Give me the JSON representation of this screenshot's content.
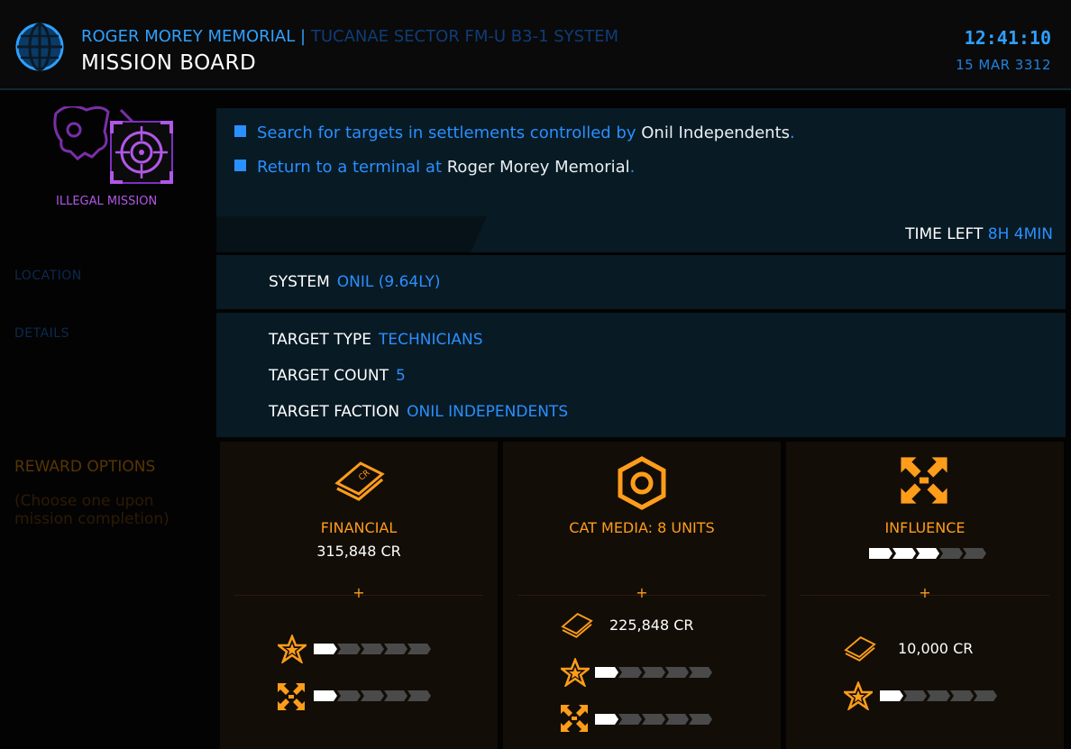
{
  "header": {
    "station": "ROGER MOREY MEMORIAL",
    "separator": "|",
    "system": "TUCANAE SECTOR FM-U B3-1 SYSTEM",
    "title": "MISSION BOARD",
    "time": "12:41:10",
    "date": "15 MAR 3312"
  },
  "mission": {
    "badge_label": "ILLEGAL MISSION",
    "objectives": [
      {
        "text": "Search for targets in settlements controlled by",
        "highlight": "Onil Independents",
        "end": "."
      },
      {
        "text": "Return to a terminal at",
        "highlight": "Roger Morey Memorial",
        "end": "."
      }
    ],
    "time_left_label": "TIME LEFT",
    "time_left_value": "8H 4MIN"
  },
  "sections": {
    "location": "LOCATION",
    "details": "DETAILS",
    "reward": "REWARD OPTIONS",
    "reward_hint": "(Choose one upon mission completion)"
  },
  "location": {
    "label": "SYSTEM",
    "value": "ONIL (9.64LY)"
  },
  "details": [
    {
      "label": "TARGET TYPE",
      "value": "TECHNICIANS"
    },
    {
      "label": "TARGET COUNT",
      "value": "5"
    },
    {
      "label": "TARGET FACTION",
      "value": "ONIL INDEPENDENTS"
    }
  ],
  "rewards": [
    {
      "title": "FINANCIAL",
      "value": "315,848 CR",
      "plus": "+",
      "icon": "credits-icon",
      "extras": [
        {
          "icon": "reputation-star-icon",
          "level": 1,
          "max": 5
        },
        {
          "icon": "influence-icon",
          "level": 1,
          "max": 5
        }
      ]
    },
    {
      "title": "CAT MEDIA: 8 UNITS",
      "value": "",
      "plus": "+",
      "icon": "commodity-hex-icon",
      "extras": [
        {
          "icon": "credits-icon",
          "text": "225,848 CR"
        },
        {
          "icon": "reputation-star-icon",
          "level": 1,
          "max": 5
        },
        {
          "icon": "influence-icon",
          "level": 1,
          "max": 5
        }
      ]
    },
    {
      "title": "INFLUENCE",
      "value": "",
      "plus": "+",
      "icon": "influence-icon",
      "main_level": 3,
      "main_max": 5,
      "extras": [
        {
          "icon": "credits-icon",
          "text": "10,000 CR"
        },
        {
          "icon": "reputation-star-icon",
          "level": 1,
          "max": 5
        }
      ]
    }
  ],
  "colors": {
    "accent_blue": "#2a8fff",
    "accent_orange": "#ff9d1a",
    "illegal_purple": "#b157e8"
  }
}
